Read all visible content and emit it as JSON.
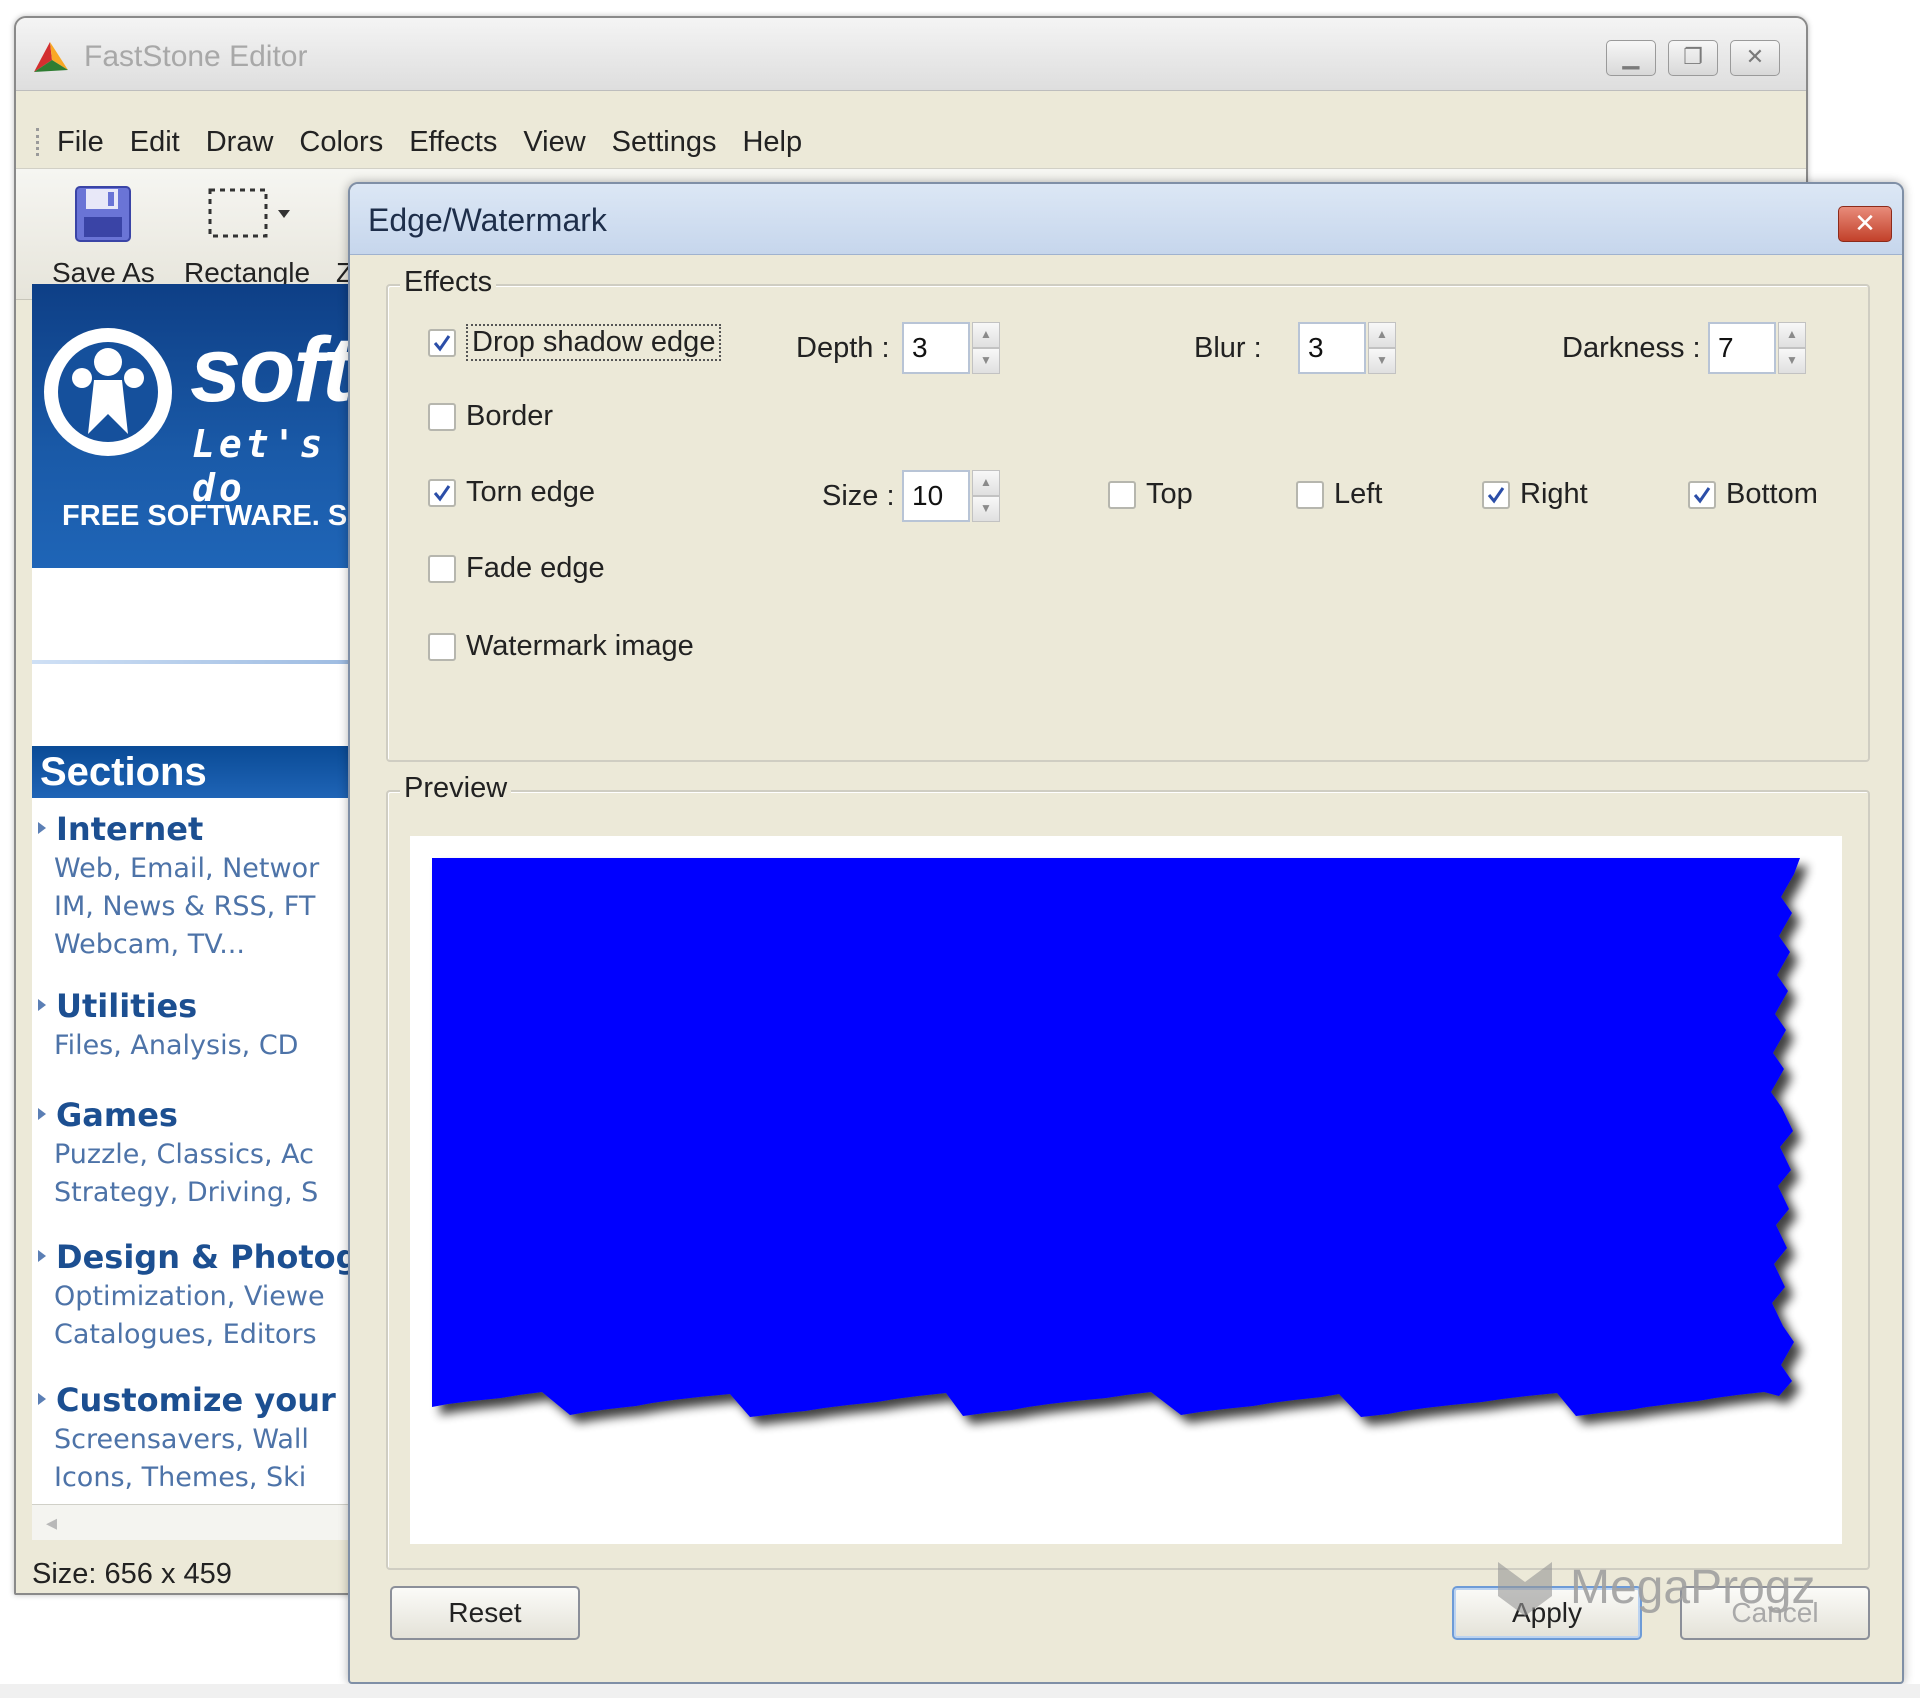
{
  "main_window": {
    "title": "FastStone Editor",
    "window_buttons": [
      "minimize",
      "restore",
      "close"
    ],
    "menu": [
      "File",
      "Edit",
      "Draw",
      "Colors",
      "Effects",
      "View",
      "Settings",
      "Help"
    ],
    "toolbar": {
      "save_as": "Save As",
      "rectangle": "Rectangle",
      "truncated": "Z",
      "more": "»"
    },
    "canvas": {
      "banner_text": "soft",
      "banner_tagline": "Let's do",
      "banner_footer": "FREE SOFTWARE. SAFE",
      "sections_header": "Sections",
      "sections": [
        {
          "title": "Internet",
          "desc": [
            "Web, Email, Networ",
            "IM, News & RSS, FT",
            "Webcam, TV..."
          ]
        },
        {
          "title": "Utilities",
          "desc": [
            "Files, Analysis, CD"
          ]
        },
        {
          "title": "Games",
          "desc": [
            "Puzzle, Classics, Ac",
            "Strategy, Driving, S"
          ]
        },
        {
          "title": "Design & Photog",
          "desc": [
            "Optimization, Viewe",
            "Catalogues, Editors"
          ]
        },
        {
          "title": "Customize your F",
          "desc": [
            "Screensavers, Wall",
            "Icons, Themes, Ski"
          ]
        }
      ]
    },
    "status": "Size: 656 x 459"
  },
  "dialog": {
    "title": "Edge/Watermark",
    "close_label": "✕",
    "effects_group_label": "Effects",
    "preview_group_label": "Preview",
    "drop_shadow": {
      "label": "Drop shadow edge",
      "checked": true,
      "depth_label": "Depth :",
      "depth": "3",
      "blur_label": "Blur :",
      "blur": "3",
      "darkness_label": "Darkness :",
      "darkness": "7"
    },
    "border": {
      "label": "Border",
      "checked": false
    },
    "torn_edge": {
      "label": "Torn edge",
      "checked": true,
      "size_label": "Size :",
      "size": "10",
      "top": {
        "label": "Top",
        "checked": false
      },
      "left": {
        "label": "Left",
        "checked": false
      },
      "right": {
        "label": "Right",
        "checked": true
      },
      "bottom": {
        "label": "Bottom",
        "checked": true
      }
    },
    "fade_edge": {
      "label": "Fade edge",
      "checked": false
    },
    "watermark_image": {
      "label": "Watermark image",
      "checked": false
    },
    "preview_fill_color": "#0000ff",
    "buttons": {
      "reset": "Reset",
      "apply": "Apply",
      "cancel": "Cancel"
    }
  },
  "watermark_text": "MegaProgz"
}
